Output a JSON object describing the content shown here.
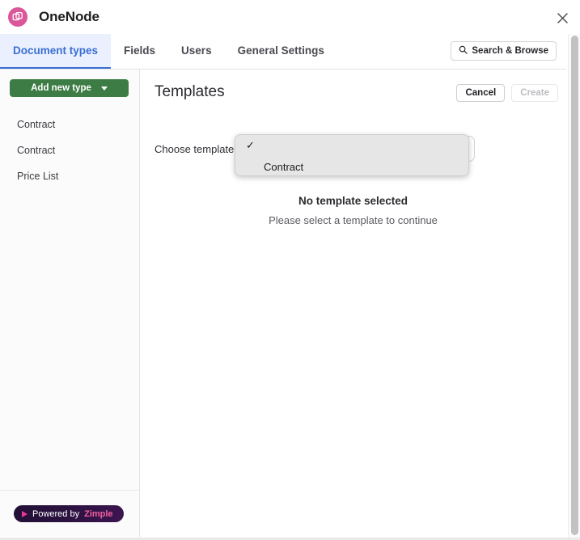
{
  "window": {
    "title": "OneNode",
    "logo_icon": "overlapping-documents-icon",
    "close_icon": "close-icon"
  },
  "tabs": [
    {
      "label": "Document types",
      "active": true
    },
    {
      "label": "Fields",
      "active": false
    },
    {
      "label": "Users",
      "active": false
    },
    {
      "label": "General Settings",
      "active": false
    }
  ],
  "search": {
    "label": "Search & Browse",
    "icon": "search-icon"
  },
  "sidebar": {
    "add_button": {
      "label": "Add new type",
      "icon": "chevron-down-icon",
      "color": "#3d7c44"
    },
    "items": [
      {
        "label": "Contract"
      },
      {
        "label": "Contract"
      },
      {
        "label": "Price List"
      }
    ],
    "footer": {
      "play_icon": "play-triangle-icon",
      "prefix": "Powered by",
      "brand": "Zimple",
      "brand_color": "#f0619f"
    }
  },
  "main": {
    "title": "Templates",
    "cancel_label": "Cancel",
    "create_label": "Create",
    "form": {
      "label": "Choose template",
      "select_value": ""
    },
    "empty_state": {
      "title": "No template selected",
      "subtitle": "Please select a template to continue"
    }
  },
  "dropdown": {
    "open": true,
    "options": [
      {
        "label": "",
        "checked": true,
        "check_glyph": "✓"
      },
      {
        "label": "Contract",
        "checked": false,
        "check_glyph": ""
      }
    ]
  }
}
